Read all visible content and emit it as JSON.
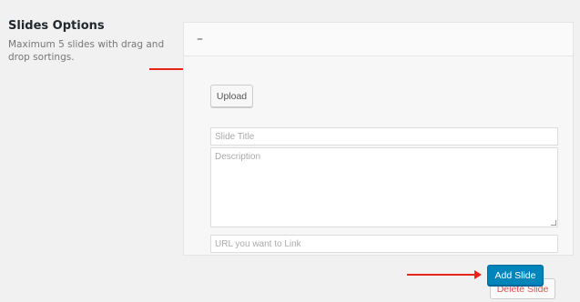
{
  "section": {
    "title": "Slides Options",
    "description": "Maximum 5 slides with drag and drop sortings."
  },
  "slide": {
    "header_label": "–",
    "upload_label": "Upload",
    "title_placeholder": "Slide Title",
    "description_placeholder": "Description",
    "url_placeholder": "URL you want to Link",
    "delete_label": "Delete Slide"
  },
  "actions": {
    "add_label": "Add Slide"
  },
  "colors": {
    "arrow": "#e8251b",
    "primary": "#0085ba",
    "danger": "#d9534f"
  },
  "icons": {
    "arrow": "arrow-right-icon",
    "resize": "resize-grip-icon"
  }
}
